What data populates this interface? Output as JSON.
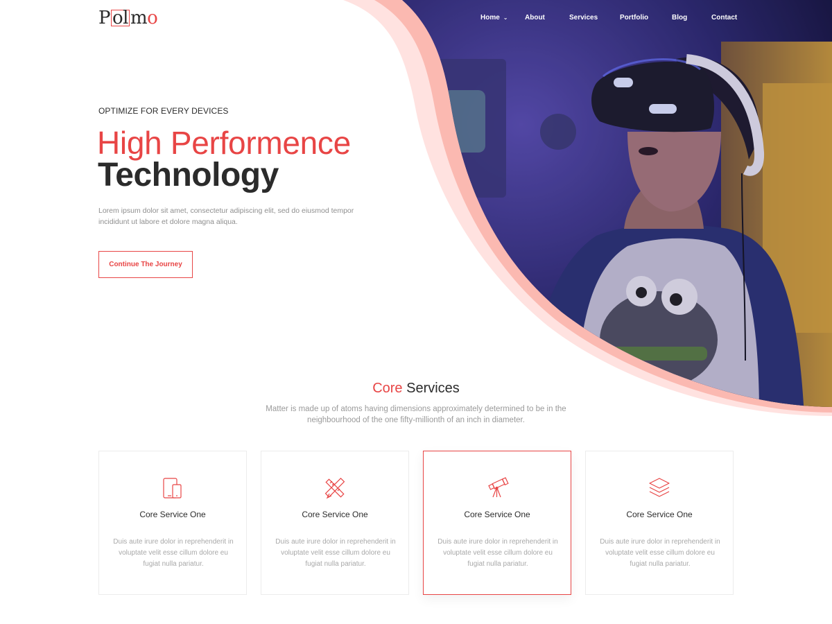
{
  "brand": {
    "logo_part1": "P",
    "logo_part2": "ol",
    "logo_part3": "m",
    "logo_part4": "o",
    "accent_color": "#e84545",
    "text_color": "#2b2b2b"
  },
  "nav": {
    "items": [
      {
        "label": "Home",
        "has_dropdown": true
      },
      {
        "label": "About"
      },
      {
        "label": "Services"
      },
      {
        "label": "Portfolio"
      },
      {
        "label": "Blog"
      },
      {
        "label": "Contact"
      }
    ],
    "dropdown_icon": "chevron-down-icon"
  },
  "hero": {
    "eyebrow": "OPTIMIZE FOR EVERY DEVICES",
    "headline_line1": "High Performence",
    "headline_line2": "Technology",
    "description": "Lorem ipsum dolor sit amet, consectetur adipiscing elit, sed do eiusmod tempor incididunt ut labore et dolore magna aliqua.",
    "cta_label": "Continue The Journey"
  },
  "services": {
    "title_accent": "Core",
    "title_rest": " Services",
    "description": "Matter is made up of atoms having dimensions approximately determined to be in the neighbourhood of the one fifty-millionth of an inch in diameter.",
    "cards": [
      {
        "icon": "devices-icon",
        "title": "Core Service One",
        "text": "Duis aute irure dolor in reprehenderit in voluptate velit esse cillum dolore eu fugiat nulla pariatur."
      },
      {
        "icon": "design-tools-icon",
        "title": "Core Service One",
        "text": "Duis aute irure dolor in reprehenderit in voluptate velit esse cillum dolore eu fugiat nulla pariatur."
      },
      {
        "icon": "telescope-icon",
        "title": "Core Service One",
        "text": "Duis aute irure dolor in reprehenderit in voluptate velit esse cillum dolore eu fugiat nulla pariatur.",
        "active": true
      },
      {
        "icon": "layers-icon",
        "title": "Core Service One",
        "text": "Duis aute irure dolor in reprehenderit in voluptate velit esse cillum dolore eu fugiat nulla pariatur."
      }
    ]
  }
}
